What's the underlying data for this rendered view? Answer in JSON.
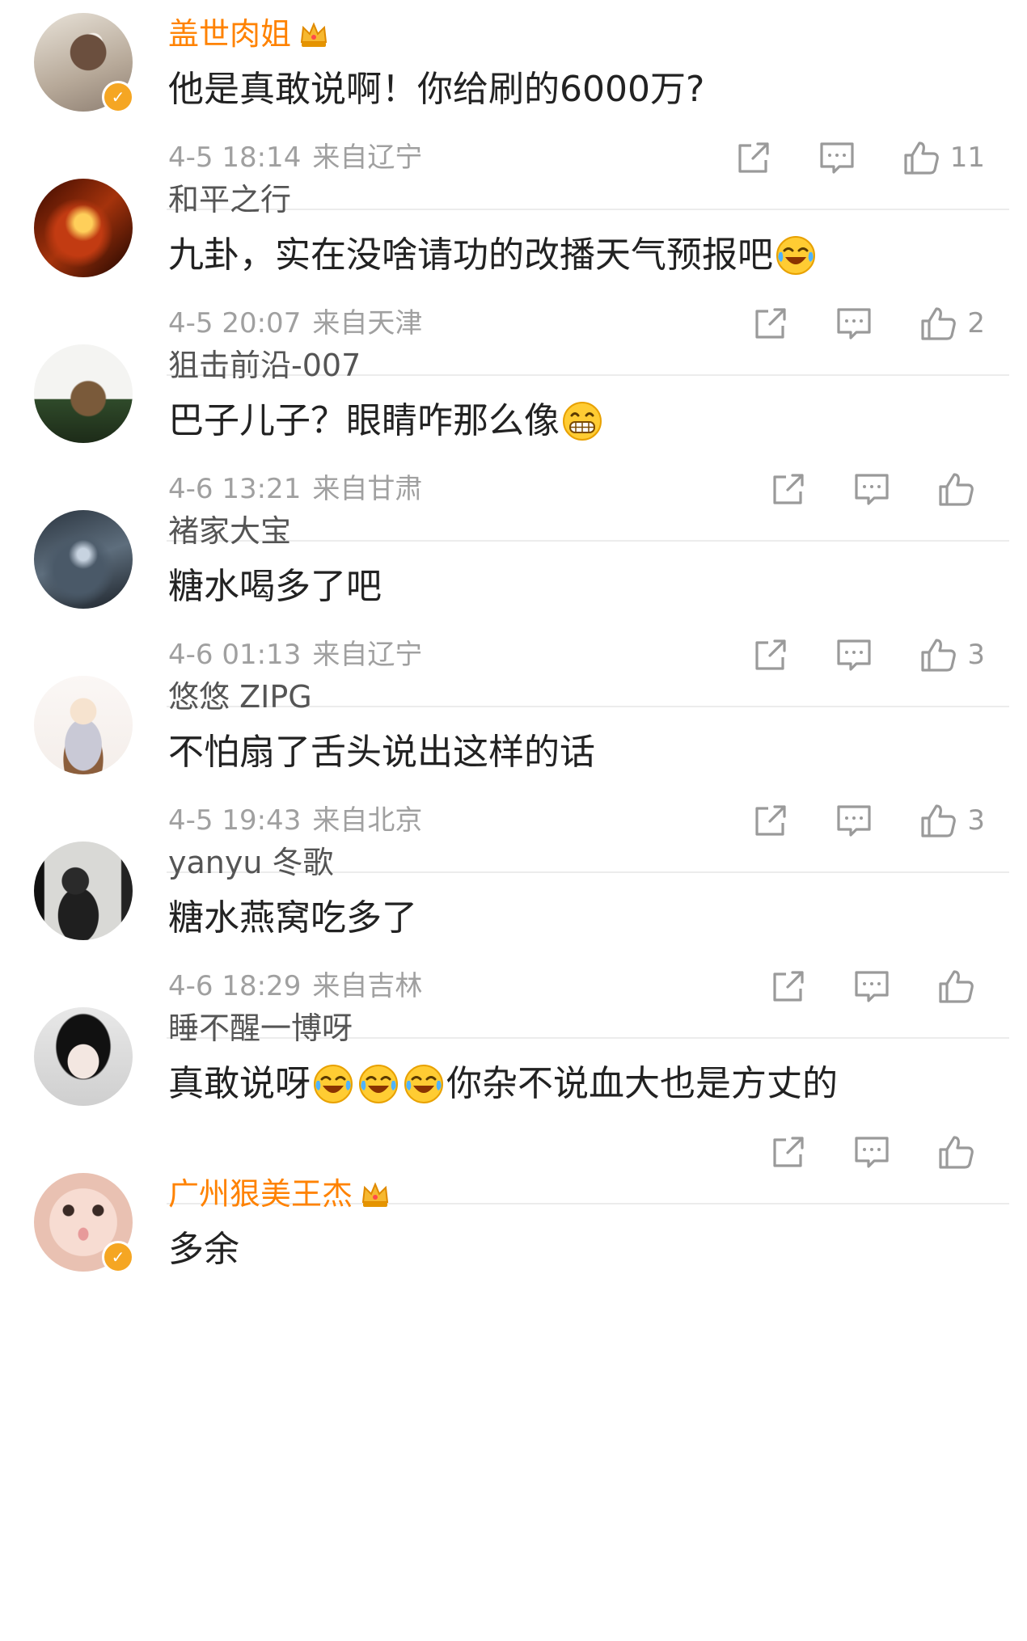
{
  "colors": {
    "vip_name": "#ff8200",
    "name": "#555555",
    "content": "#222222",
    "meta": "#a0a0a0",
    "icon": "#9a9a9a"
  },
  "comments": [
    {
      "username": "盖世肉姐",
      "vip": true,
      "verified": true,
      "crown": true,
      "segments": [
        {
          "t": "text",
          "v": "他是真敢说啊！你给刷的6000万?"
        }
      ],
      "time": "4-5 18:14",
      "location": "来自辽宁",
      "likes": "11"
    },
    {
      "username": "和平之行",
      "vip": false,
      "verified": false,
      "crown": false,
      "segments": [
        {
          "t": "text",
          "v": "九卦，实在没啥请功的改播天气预报吧"
        },
        {
          "t": "emoji",
          "v": "laugh-cry-emoji"
        }
      ],
      "time": "4-5 20:07",
      "location": "来自天津",
      "likes": "2"
    },
    {
      "username": "狙击前沿-007",
      "vip": false,
      "verified": false,
      "crown": false,
      "segments": [
        {
          "t": "text",
          "v": "巴子儿子？眼睛咋那么像"
        },
        {
          "t": "emoji",
          "v": "grin-emoji"
        }
      ],
      "time": "4-6 13:21",
      "location": "来自甘肃",
      "likes": ""
    },
    {
      "username": "褚家大宝",
      "vip": false,
      "verified": false,
      "crown": false,
      "segments": [
        {
          "t": "text",
          "v": "糖水喝多了吧"
        }
      ],
      "time": "4-6 01:13",
      "location": "来自辽宁",
      "likes": "3"
    },
    {
      "username": "悠悠 ZIPG",
      "vip": false,
      "verified": false,
      "crown": false,
      "segments": [
        {
          "t": "text",
          "v": "不怕扇了舌头说出这样的话"
        }
      ],
      "time": "4-5 19:43",
      "location": "来自北京",
      "likes": "3"
    },
    {
      "username": "yanyu 冬歌",
      "vip": false,
      "verified": false,
      "crown": false,
      "segments": [
        {
          "t": "text",
          "v": "糖水燕窝吃多了"
        }
      ],
      "time": "4-6 18:29",
      "location": "来自吉林",
      "likes": ""
    },
    {
      "username": "睡不醒一博呀",
      "vip": false,
      "verified": false,
      "crown": false,
      "segments": [
        {
          "t": "text",
          "v": "真敢说呀"
        },
        {
          "t": "emoji",
          "v": "laugh-cry-emoji"
        },
        {
          "t": "emoji",
          "v": "laugh-cry-emoji"
        },
        {
          "t": "emoji",
          "v": "laugh-cry-emoji"
        },
        {
          "t": "text",
          "v": "你杂不说血大也是方丈的"
        }
      ],
      "time": "",
      "location": "",
      "likes": ""
    },
    {
      "username": "广州狠美王杰",
      "vip": true,
      "verified": true,
      "crown": true,
      "segments": [
        {
          "t": "text",
          "v": "多余"
        }
      ],
      "time": "",
      "location": "",
      "likes": ""
    }
  ]
}
